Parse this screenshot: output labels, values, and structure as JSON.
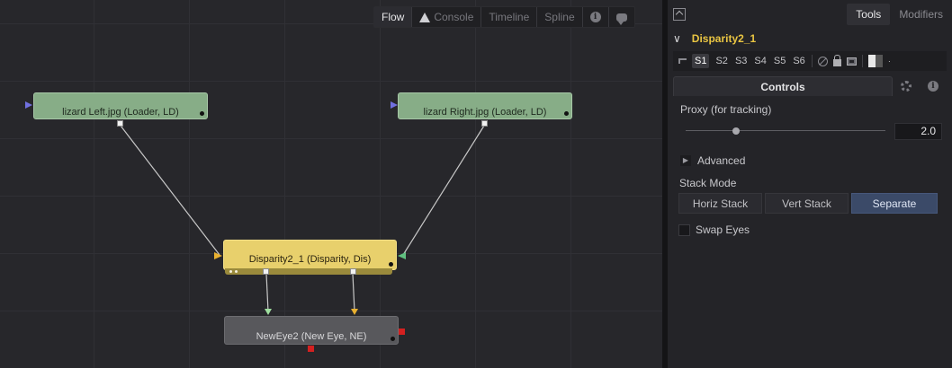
{
  "flow_tabs": [
    {
      "label": "Flow",
      "active": true
    },
    {
      "label": "Console",
      "icon": "warning-icon"
    },
    {
      "label": "Timeline"
    },
    {
      "label": "Spline"
    }
  ],
  "nodes": {
    "left_loader": "lizard Left.jpg  (Loader, LD)",
    "right_loader": "lizard Right.jpg  (Loader, LD)",
    "disparity": "Disparity2_1  (Disparity, Dis)",
    "neweye": "NewEye2  (New Eye, NE)"
  },
  "colors": {
    "loader": "#87ad87",
    "disparity": "#e8d06c",
    "neweye": "#58585c",
    "tool_title": "#e9c542",
    "active_button": "#3b4a68"
  },
  "inspector": {
    "tabs": [
      "Tools",
      "Modifiers"
    ],
    "tool_title": "Disparity2_1",
    "stereo_slots": [
      "S1",
      "S2",
      "S3",
      "S4",
      "S5",
      "S6"
    ],
    "controls_tab": "Controls",
    "proxy_label": "Proxy (for tracking)",
    "proxy_value": "2.0",
    "proxy_fraction": 0.25,
    "advanced_label": "Advanced",
    "stack_mode_label": "Stack Mode",
    "stack_buttons": [
      "Horiz Stack",
      "Vert Stack",
      "Separate"
    ],
    "stack_selected": "Separate",
    "swap_eyes_label": "Swap Eyes",
    "swap_eyes_checked": false
  }
}
